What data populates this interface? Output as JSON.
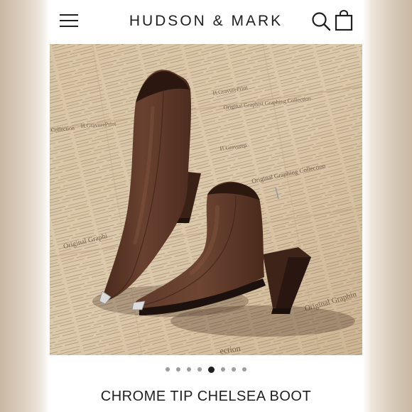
{
  "header": {
    "brand": "HUDSON & MARK",
    "menu_icon": "hamburger-menu-icon",
    "search_icon": "search-icon",
    "cart_icon": "shopping-bag-icon"
  },
  "product_image": {
    "subject": "brown leather pointed-toe ankle boots with chrome toe tips and block heels on newspaper background",
    "background_texts": [
      "H.GravurePrint",
      "Original Graphist Graphing Collection",
      "H.Gravurep",
      "Original Graphing Collection",
      "Collection",
      "Original Graphi",
      "H.GravurePrint",
      "Original Graphin",
      "ection"
    ]
  },
  "carousel": {
    "total": 8,
    "active_index": 4
  },
  "product": {
    "title": "CHROME TIP CHELSEA BOOT"
  },
  "colors": {
    "boot": "#5a3526",
    "boot_shadow": "#3c2118",
    "newspaper": "#d8c3a2",
    "chrome": "#cfcfcf",
    "text": "#1f1f1f"
  }
}
